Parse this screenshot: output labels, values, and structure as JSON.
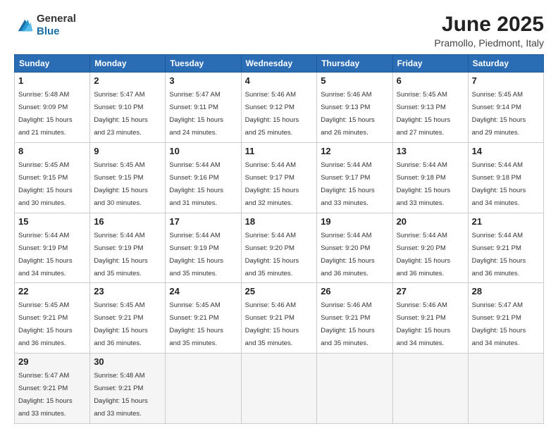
{
  "logo": {
    "general": "General",
    "blue": "Blue"
  },
  "title": "June 2025",
  "location": "Pramollo, Piedmont, Italy",
  "headers": [
    "Sunday",
    "Monday",
    "Tuesday",
    "Wednesday",
    "Thursday",
    "Friday",
    "Saturday"
  ],
  "weeks": [
    [
      {
        "day": "1",
        "sunrise": "5:48 AM",
        "sunset": "9:09 PM",
        "daylight": "15 hours and 21 minutes."
      },
      {
        "day": "2",
        "sunrise": "5:47 AM",
        "sunset": "9:10 PM",
        "daylight": "15 hours and 23 minutes."
      },
      {
        "day": "3",
        "sunrise": "5:47 AM",
        "sunset": "9:11 PM",
        "daylight": "15 hours and 24 minutes."
      },
      {
        "day": "4",
        "sunrise": "5:46 AM",
        "sunset": "9:12 PM",
        "daylight": "15 hours and 25 minutes."
      },
      {
        "day": "5",
        "sunrise": "5:46 AM",
        "sunset": "9:13 PM",
        "daylight": "15 hours and 26 minutes."
      },
      {
        "day": "6",
        "sunrise": "5:45 AM",
        "sunset": "9:13 PM",
        "daylight": "15 hours and 27 minutes."
      },
      {
        "day": "7",
        "sunrise": "5:45 AM",
        "sunset": "9:14 PM",
        "daylight": "15 hours and 29 minutes."
      }
    ],
    [
      {
        "day": "8",
        "sunrise": "5:45 AM",
        "sunset": "9:15 PM",
        "daylight": "15 hours and 30 minutes."
      },
      {
        "day": "9",
        "sunrise": "5:45 AM",
        "sunset": "9:15 PM",
        "daylight": "15 hours and 30 minutes."
      },
      {
        "day": "10",
        "sunrise": "5:44 AM",
        "sunset": "9:16 PM",
        "daylight": "15 hours and 31 minutes."
      },
      {
        "day": "11",
        "sunrise": "5:44 AM",
        "sunset": "9:17 PM",
        "daylight": "15 hours and 32 minutes."
      },
      {
        "day": "12",
        "sunrise": "5:44 AM",
        "sunset": "9:17 PM",
        "daylight": "15 hours and 33 minutes."
      },
      {
        "day": "13",
        "sunrise": "5:44 AM",
        "sunset": "9:18 PM",
        "daylight": "15 hours and 33 minutes."
      },
      {
        "day": "14",
        "sunrise": "5:44 AM",
        "sunset": "9:18 PM",
        "daylight": "15 hours and 34 minutes."
      }
    ],
    [
      {
        "day": "15",
        "sunrise": "5:44 AM",
        "sunset": "9:19 PM",
        "daylight": "15 hours and 34 minutes."
      },
      {
        "day": "16",
        "sunrise": "5:44 AM",
        "sunset": "9:19 PM",
        "daylight": "15 hours and 35 minutes."
      },
      {
        "day": "17",
        "sunrise": "5:44 AM",
        "sunset": "9:19 PM",
        "daylight": "15 hours and 35 minutes."
      },
      {
        "day": "18",
        "sunrise": "5:44 AM",
        "sunset": "9:20 PM",
        "daylight": "15 hours and 35 minutes."
      },
      {
        "day": "19",
        "sunrise": "5:44 AM",
        "sunset": "9:20 PM",
        "daylight": "15 hours and 36 minutes."
      },
      {
        "day": "20",
        "sunrise": "5:44 AM",
        "sunset": "9:20 PM",
        "daylight": "15 hours and 36 minutes."
      },
      {
        "day": "21",
        "sunrise": "5:44 AM",
        "sunset": "9:21 PM",
        "daylight": "15 hours and 36 minutes."
      }
    ],
    [
      {
        "day": "22",
        "sunrise": "5:45 AM",
        "sunset": "9:21 PM",
        "daylight": "15 hours and 36 minutes."
      },
      {
        "day": "23",
        "sunrise": "5:45 AM",
        "sunset": "9:21 PM",
        "daylight": "15 hours and 36 minutes."
      },
      {
        "day": "24",
        "sunrise": "5:45 AM",
        "sunset": "9:21 PM",
        "daylight": "15 hours and 35 minutes."
      },
      {
        "day": "25",
        "sunrise": "5:46 AM",
        "sunset": "9:21 PM",
        "daylight": "15 hours and 35 minutes."
      },
      {
        "day": "26",
        "sunrise": "5:46 AM",
        "sunset": "9:21 PM",
        "daylight": "15 hours and 35 minutes."
      },
      {
        "day": "27",
        "sunrise": "5:46 AM",
        "sunset": "9:21 PM",
        "daylight": "15 hours and 34 minutes."
      },
      {
        "day": "28",
        "sunrise": "5:47 AM",
        "sunset": "9:21 PM",
        "daylight": "15 hours and 34 minutes."
      }
    ],
    [
      {
        "day": "29",
        "sunrise": "5:47 AM",
        "sunset": "9:21 PM",
        "daylight": "15 hours and 33 minutes."
      },
      {
        "day": "30",
        "sunrise": "5:48 AM",
        "sunset": "9:21 PM",
        "daylight": "15 hours and 33 minutes."
      },
      null,
      null,
      null,
      null,
      null
    ]
  ]
}
